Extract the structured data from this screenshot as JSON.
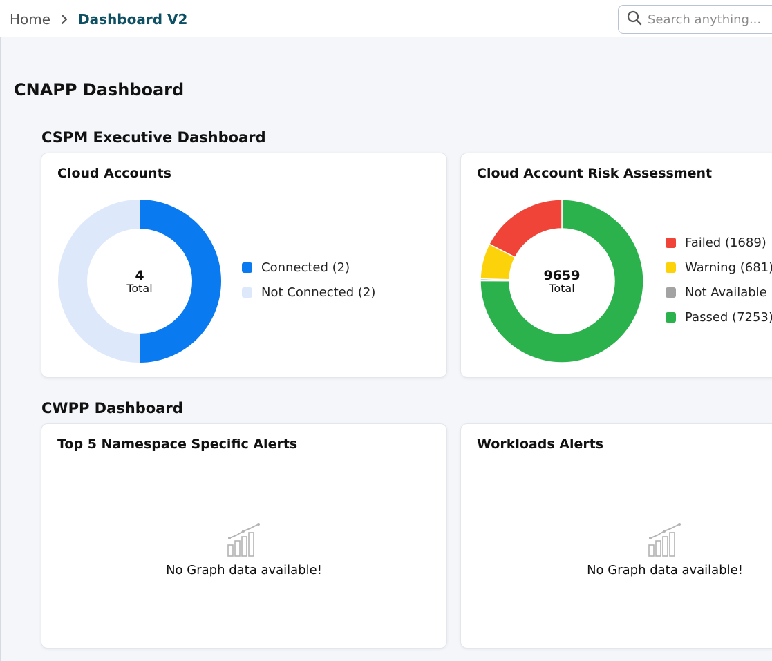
{
  "breadcrumb": {
    "home": "Home",
    "current": "Dashboard V2"
  },
  "search": {
    "placeholder": "Search anything..."
  },
  "page_title": "CNAPP Dashboard",
  "sections": {
    "cspm": {
      "title": "CSPM Executive Dashboard",
      "cloud_accounts": {
        "title": "Cloud Accounts",
        "total_value": "4",
        "total_label": "Total",
        "legend": [
          {
            "label": "Connected (2)",
            "color": "#0a7af0",
            "value": 2
          },
          {
            "label": "Not Connected (2)",
            "color": "#dde9fb",
            "value": 2
          }
        ]
      },
      "risk_assessment": {
        "title": "Cloud Account Risk Assessment",
        "total_value": "9659",
        "total_label": "Total",
        "legend": [
          {
            "label": "Failed (1689)",
            "color": "#f04438",
            "value": 1689
          },
          {
            "label": "Warning (681)",
            "color": "#fcd30a",
            "value": 681
          },
          {
            "label": "Not Available (",
            "color": "#a3a3a3",
            "value": 36
          },
          {
            "label": "Passed (7253)",
            "color": "#2bb24c",
            "value": 7253
          }
        ]
      }
    },
    "cwpp": {
      "title": "CWPP Dashboard",
      "namespace_alerts": {
        "title": "Top 5 Namespace Specific Alerts",
        "empty_text": "No Graph data available!",
        "icon": "bar-chart-icon"
      },
      "workload_alerts": {
        "title": "Workloads Alerts",
        "empty_text": "No Graph data available!",
        "icon": "bar-chart-icon"
      }
    }
  }
}
